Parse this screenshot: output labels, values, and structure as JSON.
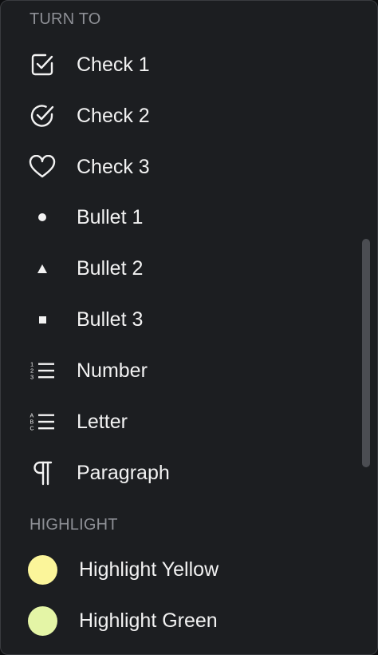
{
  "turn_to": {
    "header": "TURN TO",
    "items": [
      {
        "label": "Check 1",
        "icon": "checkbox-square-icon"
      },
      {
        "label": "Check 2",
        "icon": "check-circle-icon"
      },
      {
        "label": "Check 3",
        "icon": "heart-icon"
      },
      {
        "label": "Bullet 1",
        "icon": "bullet-dot-icon"
      },
      {
        "label": "Bullet 2",
        "icon": "bullet-triangle-icon"
      },
      {
        "label": "Bullet 3",
        "icon": "bullet-square-icon"
      },
      {
        "label": "Number",
        "icon": "numbered-list-icon"
      },
      {
        "label": "Letter",
        "icon": "lettered-list-icon"
      },
      {
        "label": "Paragraph",
        "icon": "pilcrow-icon"
      }
    ]
  },
  "highlight": {
    "header": "HIGHLIGHT",
    "items": [
      {
        "label": "Highlight Yellow",
        "color": "#fbf59a"
      },
      {
        "label": "Highlight Green",
        "color": "#e4f5a6"
      }
    ]
  },
  "icon_glyphs": {
    "numbered_list": [
      "1",
      "2",
      "3"
    ],
    "lettered_list": [
      "A",
      "B",
      "C"
    ]
  }
}
